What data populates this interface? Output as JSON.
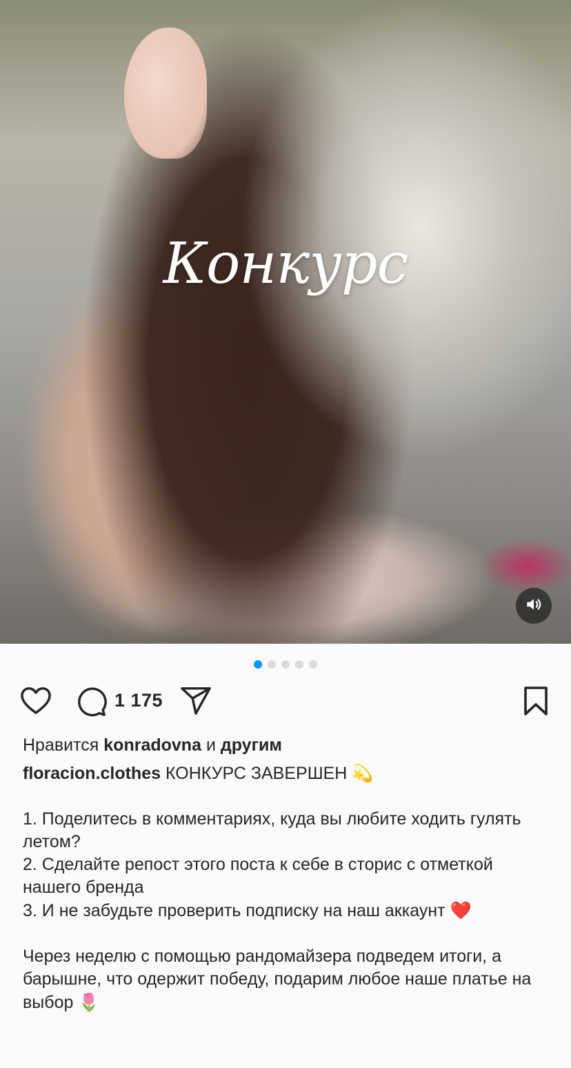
{
  "post": {
    "image_caption": "Конкурс",
    "carousel_count": 5,
    "carousel_active_index": 0
  },
  "actions": {
    "comment_count": "1 175"
  },
  "likes": {
    "prefix": "Нравится",
    "user": "konradovna",
    "connector": "и",
    "others": "другим"
  },
  "caption": {
    "username": "floracion.clothes",
    "headline": "КОНКУРС ЗАВЕРШЕН",
    "headline_emoji": "💫",
    "line1": "1. Поделитесь в комментариях, куда вы любите ходить гулять летом?",
    "line2": "2. Сделайте репост этого поста к себе в сторис с отметкой нашего бренда",
    "line3": "3. И не забудьте проверить подписку на наш аккаунт",
    "line3_emoji": "❤️",
    "closing": "Через неделю с помощью рандомайзера подведем итоги, а барышне, что одержит победу, подарим любое наше платье на выбор",
    "closing_emoji": "🌷"
  },
  "icons": {
    "like": "heart-icon",
    "comment": "comment-icon",
    "share": "paper-plane-icon",
    "save": "bookmark-icon",
    "sound": "speaker-icon"
  },
  "colors": {
    "accent": "#0095f6",
    "text": "#262626",
    "background": "#fafafa"
  }
}
